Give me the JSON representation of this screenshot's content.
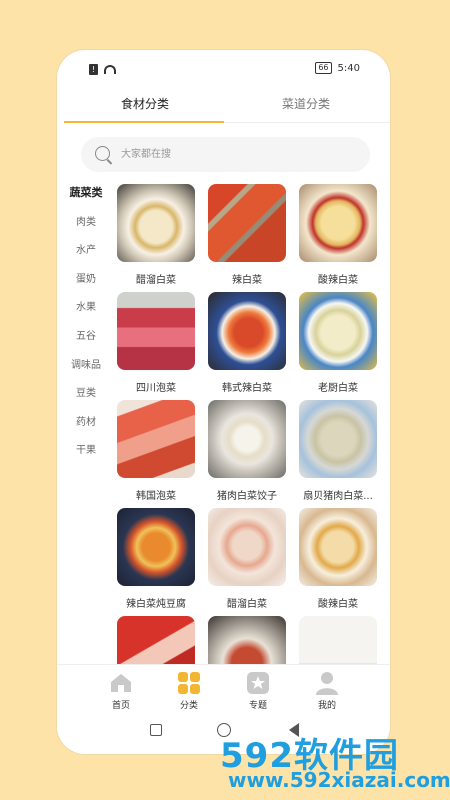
{
  "status": {
    "sim_label": "!",
    "battery": "66",
    "time": "5:40"
  },
  "tabs": [
    {
      "label": "食材分类"
    },
    {
      "label": "菜道分类"
    }
  ],
  "search": {
    "placeholder": "大家都在搜"
  },
  "sidebar": {
    "items": [
      {
        "label": "蔬菜类"
      },
      {
        "label": "肉类"
      },
      {
        "label": "水产"
      },
      {
        "label": "蛋奶"
      },
      {
        "label": "水果"
      },
      {
        "label": "五谷"
      },
      {
        "label": "调味品"
      },
      {
        "label": "豆类"
      },
      {
        "label": "药材"
      },
      {
        "label": "干果"
      }
    ]
  },
  "grid": {
    "items": [
      {
        "label": "醋溜白菜"
      },
      {
        "label": "辣白菜"
      },
      {
        "label": "酸辣白菜"
      },
      {
        "label": "四川泡菜"
      },
      {
        "label": "韩式辣白菜"
      },
      {
        "label": "老厨白菜"
      },
      {
        "label": "韩国泡菜"
      },
      {
        "label": "猪肉白菜饺子"
      },
      {
        "label": "扇贝猪肉白菜..."
      },
      {
        "label": "辣白菜炖豆腐"
      },
      {
        "label": "醋溜白菜"
      },
      {
        "label": "酸辣白菜"
      },
      {
        "label": ""
      },
      {
        "label": ""
      },
      {
        "label": ""
      }
    ]
  },
  "bottomnav": {
    "items": [
      {
        "label": "首页"
      },
      {
        "label": "分类"
      },
      {
        "label": "专题"
      },
      {
        "label": "我的"
      }
    ]
  },
  "watermark": {
    "logo": "592软件园",
    "url": "www.592xiazai.com"
  },
  "colors": {
    "accent": "#f2b632",
    "background": "#fde3a7",
    "watermark": "#1f9ee0"
  }
}
